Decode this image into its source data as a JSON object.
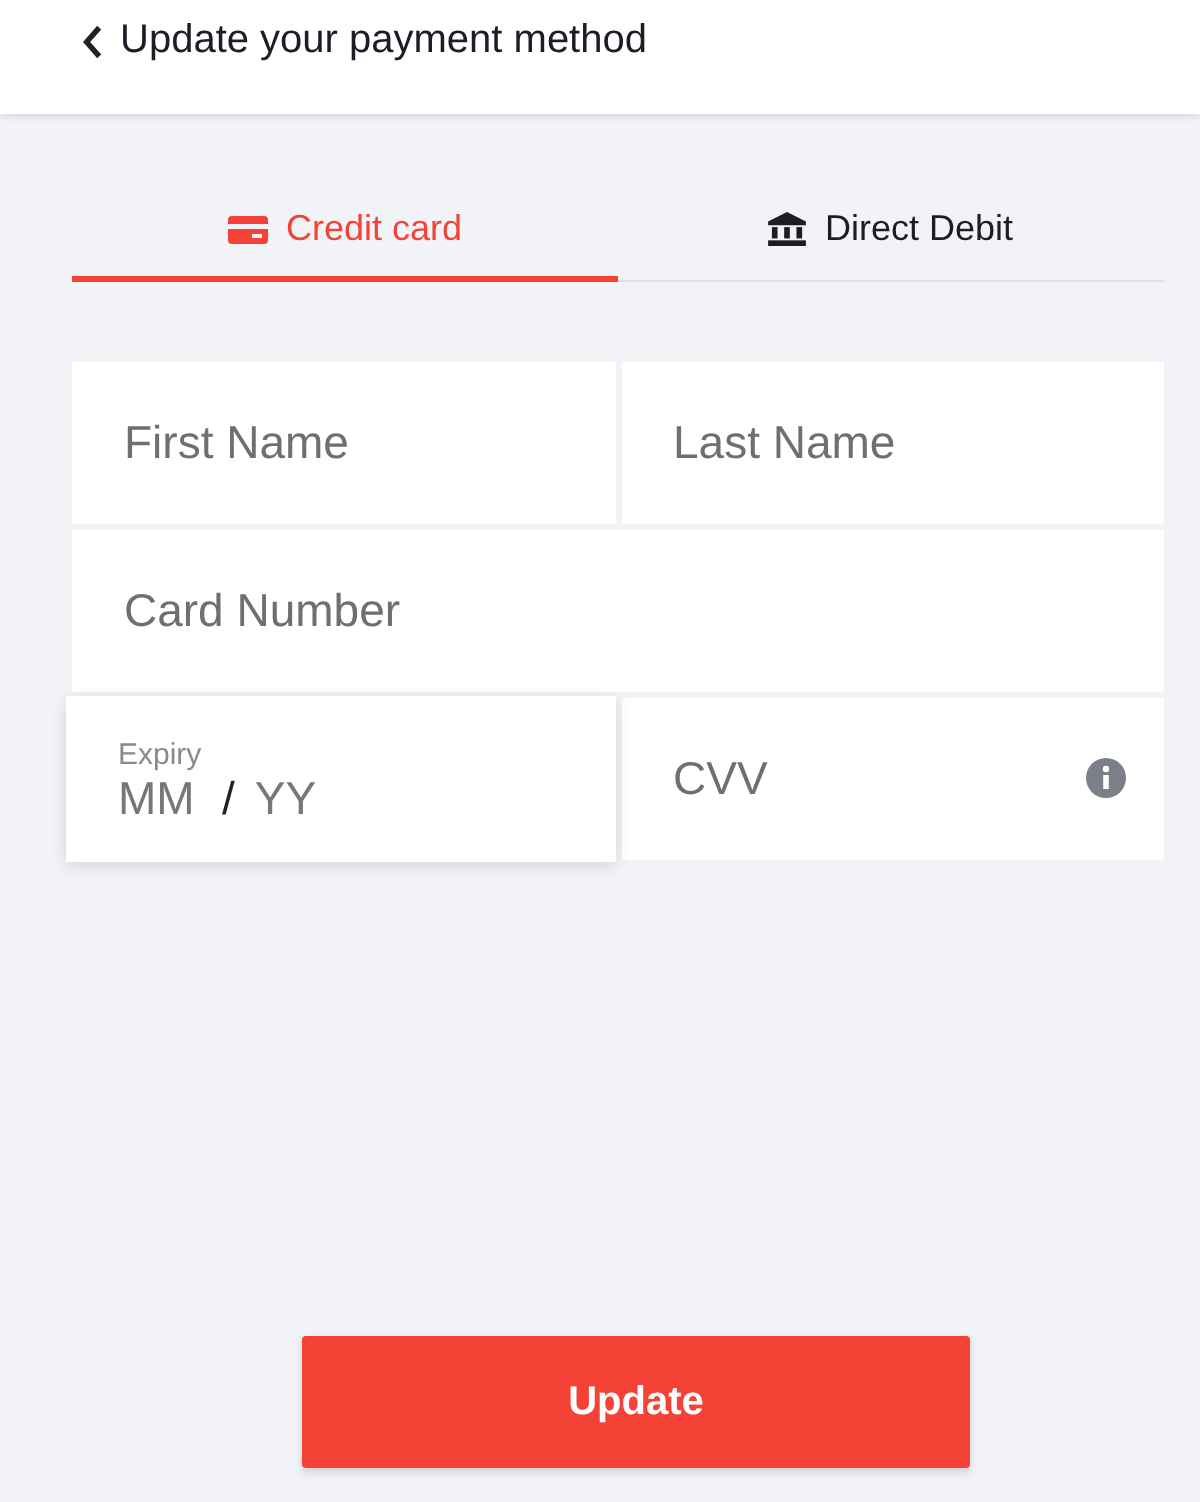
{
  "header": {
    "title": "Update your payment method"
  },
  "tabs": [
    {
      "label": "Credit card",
      "kind": "card",
      "selected": true
    },
    {
      "label": "Direct Debit",
      "kind": "bank",
      "selected": false
    }
  ],
  "fields": [
    {
      "kind": "text",
      "placeholder": "First Name",
      "focused": false
    },
    {
      "kind": "text",
      "placeholder": "Last Name",
      "focused": false
    },
    {
      "kind": "wide",
      "placeholder": "Card Number",
      "focused": false
    },
    {
      "kind": "expiry",
      "label": "Expiry",
      "month_placeholder": "MM",
      "separator": "/",
      "year_placeholder": "YY",
      "focused": true
    },
    {
      "kind": "cvv",
      "placeholder": "CVV",
      "focused": false
    }
  ],
  "submit": {
    "label": "Update"
  }
}
